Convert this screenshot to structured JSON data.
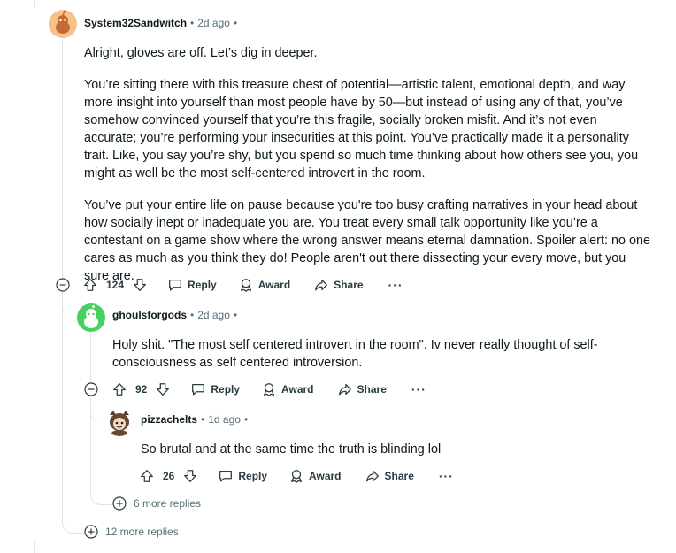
{
  "comments": {
    "c1": {
      "author": "System32Sandwitch",
      "time": "2d ago",
      "paragraphs": [
        "Alright, gloves are off. Let’s dig in deeper.",
        "You’re sitting there with this treasure chest of potential—artistic talent, emotional depth, and way more insight into yourself than most people have by 50—but instead of using any of that, you’ve somehow convinced yourself that you’re this fragile, socially broken misfit. And it’s not even accurate; you’re performing your insecurities at this point. You’ve practically made it a personality trait. Like, you say you’re shy, but you spend so much time thinking about how others see you, you might as well be the most self-centered introvert in the room.",
        "You’ve put your entire life on pause because you're too busy crafting narratives in your head about how socially inept or inadequate you are. You treat every small talk opportunity like you’re a contestant on a game show where the wrong answer means eternal damnation. Spoiler alert: no one cares as much as you think they do! People aren't out there dissecting your every move, but you sure are."
      ],
      "score": "124"
    },
    "c2": {
      "author": "ghoulsforgods",
      "time": "2d ago",
      "paragraphs": [
        "Holy shit. \"The most self centered introvert in the room\". Iv never really thought of self-consciousness as self centered introversion."
      ],
      "score": "92"
    },
    "c3": {
      "author": "pizzachelts",
      "time": "1d ago",
      "paragraphs": [
        "So brutal and at the same time the truth is blinding lol"
      ],
      "score": "26"
    }
  },
  "actions": {
    "reply": "Reply",
    "award": "Award",
    "share": "Share"
  },
  "more_replies": {
    "nested": "6 more replies",
    "top": "12 more replies"
  },
  "colors": {
    "text": "#0f1a1c",
    "meta": "#576f76",
    "thread_line": "#e0e3e5",
    "avatar1_bg": "#f5c28b",
    "avatar2_bg": "#46d160"
  },
  "icons": {
    "upvote": "arrow-up-icon",
    "downvote": "arrow-down-icon",
    "reply": "speech-bubble-icon",
    "award": "award-icon",
    "share": "share-arrow-icon",
    "overflow": "ellipsis-icon",
    "collapse": "minus-circle-icon",
    "expand": "plus-circle-icon"
  }
}
